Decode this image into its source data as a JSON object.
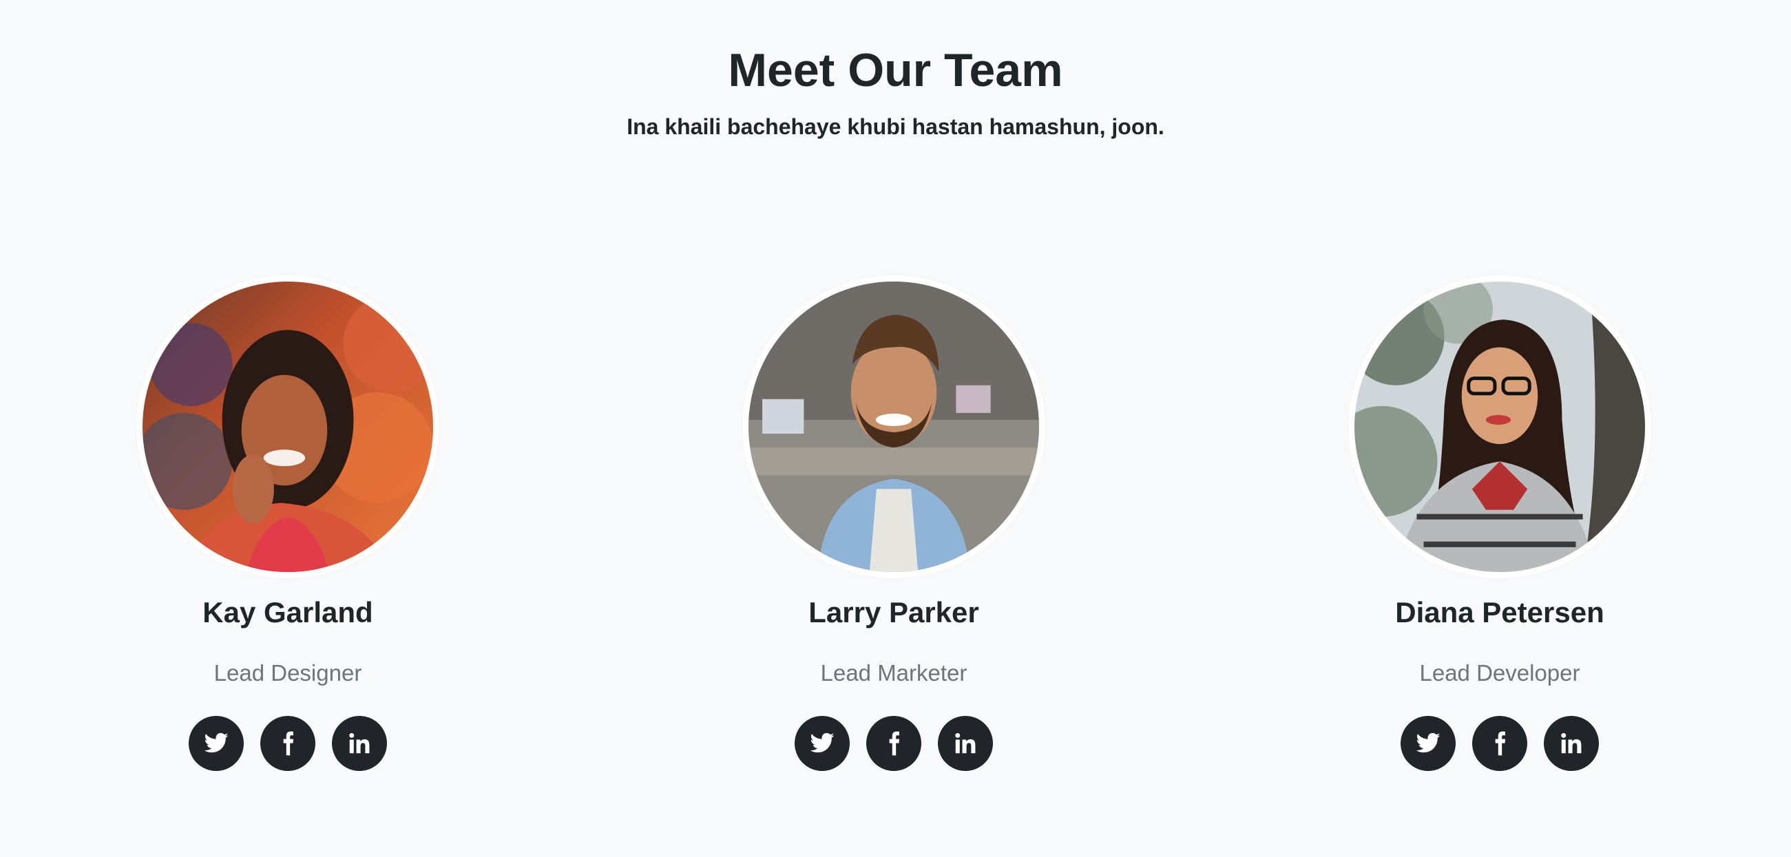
{
  "section": {
    "title": "Meet Our Team",
    "subtitle": "Ina khaili bachehaye khubi hastan hamashun, joon."
  },
  "members": [
    {
      "name": "Kay Garland",
      "role": "Lead Designer",
      "photo": "woman with colored powder at festival",
      "socials": [
        "twitter-icon",
        "facebook-icon",
        "linkedin-icon"
      ]
    },
    {
      "name": "Larry Parker",
      "role": "Lead Marketer",
      "photo": "smiling bearded man in denim shirt in office",
      "socials": [
        "twitter-icon",
        "facebook-icon",
        "linkedin-icon"
      ]
    },
    {
      "name": "Diana Petersen",
      "role": "Lead Developer",
      "photo": "woman with glasses and plaid scarf by tree",
      "socials": [
        "twitter-icon",
        "facebook-icon",
        "linkedin-icon"
      ]
    }
  ],
  "colors": {
    "background": "#f8f9fa",
    "text": "#212529",
    "muted": "#6c757d",
    "icon_bg": "#212529"
  }
}
